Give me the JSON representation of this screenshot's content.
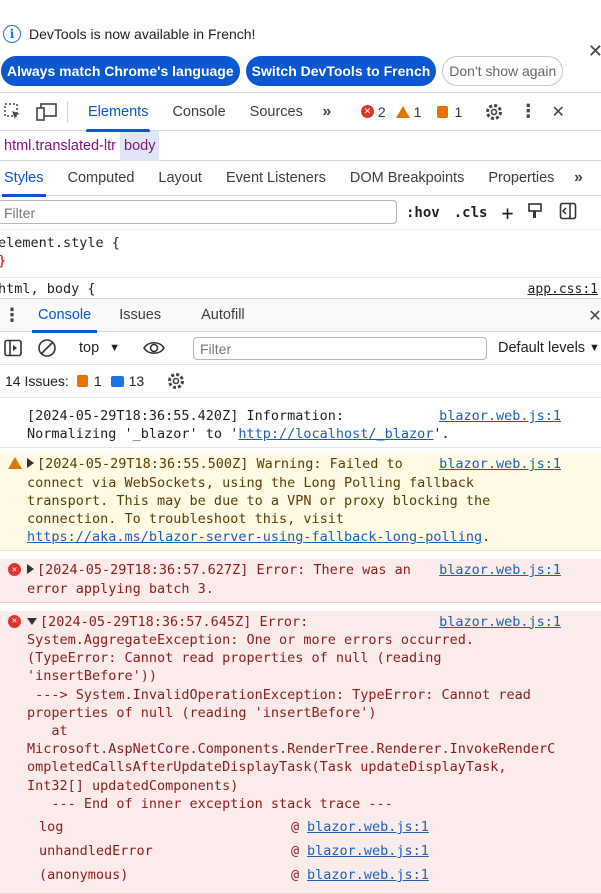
{
  "infobar": {
    "message": "DevTools is now available in French!",
    "buttons": [
      "Always match Chrome's language",
      "Switch DevTools to French",
      "Don't show again"
    ]
  },
  "toolbar": {
    "tabs": [
      "Elements",
      "Console",
      "Sources"
    ],
    "active_tab": "Elements",
    "error_count": "2",
    "warning_count": "1",
    "issue_count": "1"
  },
  "breadcrumbs": [
    "html.translated-ltr",
    "body"
  ],
  "styles_panel": {
    "tabs": [
      "Styles",
      "Computed",
      "Layout",
      "Event Listeners",
      "DOM Breakpoints",
      "Properties"
    ],
    "filter_placeholder": "Filter",
    "hov": ":hov",
    "cls": ".cls",
    "rule1_selector": "element.style {",
    "rule1_close": "}",
    "rule2_selector": "html, body {",
    "rule2_source": "app.css:1"
  },
  "drawer": {
    "tabs": [
      "Console",
      "Issues",
      "Autofill"
    ],
    "context": "top",
    "filter_placeholder": "Filter",
    "levels": "Default levels",
    "issues_label": "14 Issues:",
    "issues_orange": "1",
    "issues_blue": "13"
  },
  "messages": [
    {
      "level": "info",
      "text": "[2024-05-29T18:36:55.420Z] Information:\nNormalizing '_blazor' to '",
      "link": "http://localhost/_blazor",
      "tail": "'.",
      "source": "blazor.web.js:1"
    },
    {
      "level": "warning",
      "text": "[2024-05-29T18:36:55.500Z] Warning: Failed to\nconnect via WebSockets, using the Long Polling fallback\ntransport. This may be due to a VPN or proxy blocking the\nconnection. To troubleshoot this, visit\n",
      "link": "https://aka.ms/blazor-server-using-fallback-long-polling",
      "tail": ".",
      "source": "blazor.web.js:1"
    },
    {
      "level": "error",
      "text": "[2024-05-29T18:36:57.627Z] Error: There was an\nerror applying batch 3.",
      "source": "blazor.web.js:1"
    },
    {
      "level": "error",
      "text": "[2024-05-29T18:36:57.645Z] Error:\nSystem.AggregateException: One or more errors occurred.\n(TypeError: Cannot read properties of null (reading\n'insertBefore'))\n ---> System.InvalidOperationException: TypeError: Cannot read\nproperties of null (reading 'insertBefore')\n   at\nMicrosoft.AspNetCore.Components.RenderTree.Renderer.InvokeRenderC\nompletedCallsAfterUpdateDisplayTask(Task updateDisplayTask,\nInt32[] updatedComponents)\n   --- End of inner exception stack trace ---",
      "source": "blazor.web.js:1",
      "stack": [
        {
          "fn": "log",
          "at": "@",
          "src": "blazor.web.js:1"
        },
        {
          "fn": "unhandledError",
          "at": "@",
          "src": "blazor.web.js:1"
        },
        {
          "fn": "(anonymous)",
          "at": "@",
          "src": "blazor.web.js:1"
        }
      ]
    }
  ]
}
